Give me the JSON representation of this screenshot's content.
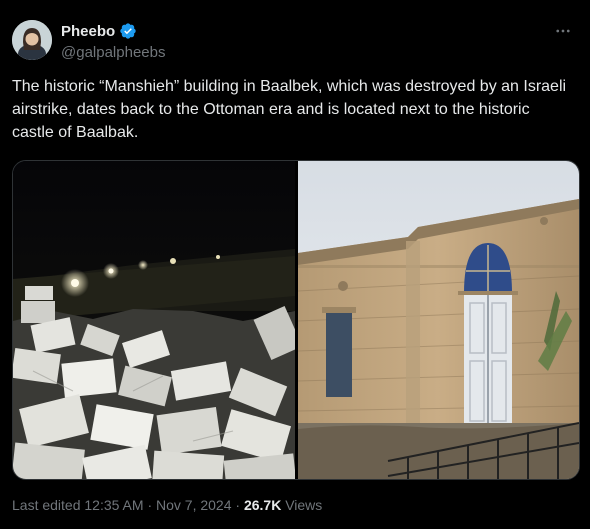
{
  "author": {
    "display_name": "Pheebo",
    "handle": "@galpalpheebs",
    "verified": true,
    "avatar_icon": "user-avatar"
  },
  "tweet": {
    "text": "The historic “Manshieh” building in Baalbek, which was destroyed by an Israeli airstrike, dates back to the Ottoman era and is located next to the historic castle of Baalbak."
  },
  "media": {
    "left_photo_icon": "rubble-night-photo",
    "right_photo_icon": "ottoman-building-photo"
  },
  "footer": {
    "edited_label": "Last edited",
    "time": "12:35 AM",
    "separator": "·",
    "date": "Nov 7, 2024",
    "views_count": "26.7K",
    "views_label": "Views"
  },
  "colors": {
    "background": "#000000",
    "text_primary": "#e7e9ea",
    "text_secondary": "#71767b",
    "verified_blue": "#1d9bf0",
    "border": "#2f3336"
  }
}
